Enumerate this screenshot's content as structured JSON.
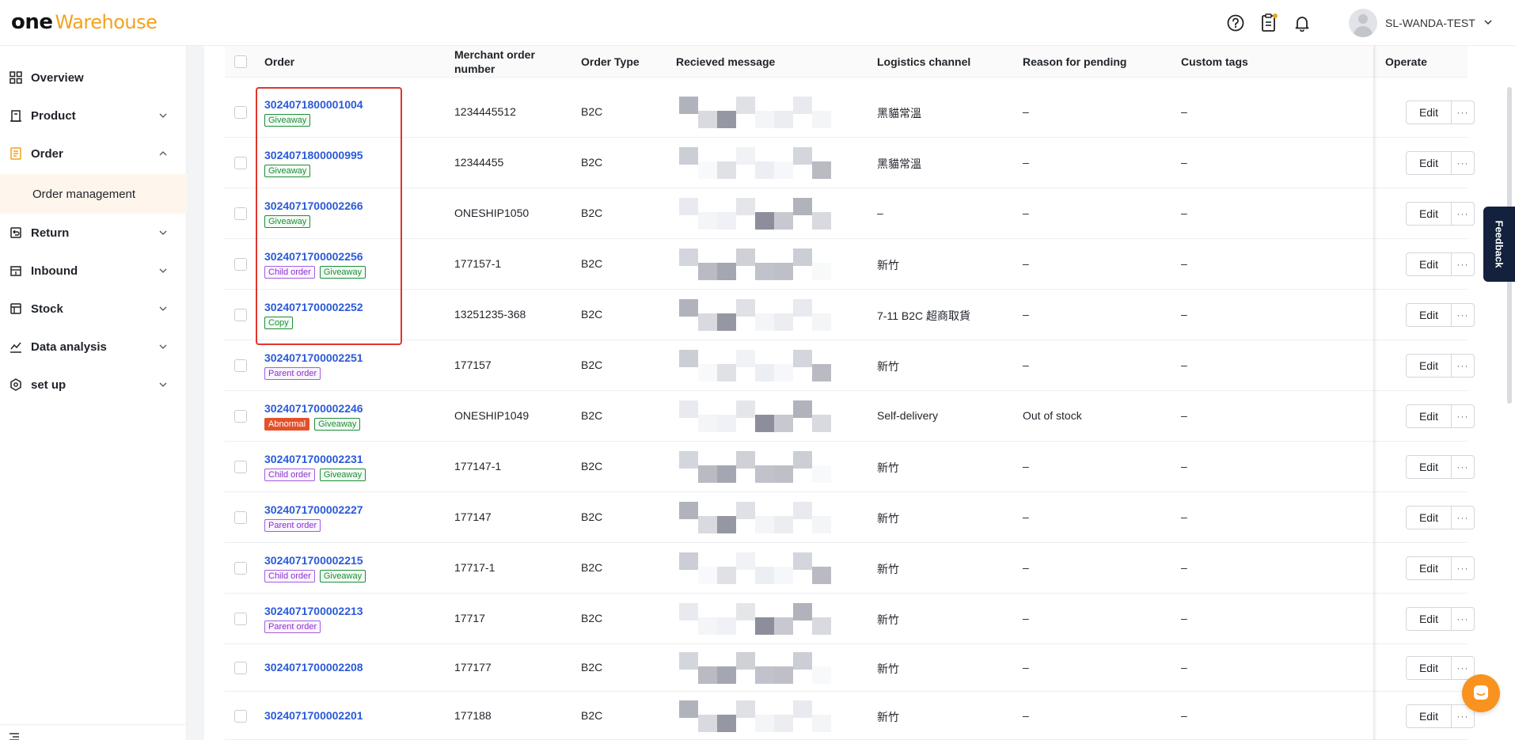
{
  "brand": {
    "one": "one",
    "warehouse": "Warehouse",
    "accent": "#f4a21c"
  },
  "header": {
    "username": "SL-WANDA-TEST"
  },
  "sidebar": {
    "items": [
      {
        "label": "Overview",
        "icon": "overview-icon"
      },
      {
        "label": "Product",
        "icon": "product-icon"
      },
      {
        "label": "Order",
        "icon": "order-icon"
      },
      {
        "label": "Return",
        "icon": "return-icon"
      },
      {
        "label": "Inbound",
        "icon": "inbound-icon"
      },
      {
        "label": "Stock",
        "icon": "stock-icon"
      },
      {
        "label": "Data analysis",
        "icon": "data-analysis-icon"
      },
      {
        "label": "set up",
        "icon": "setup-icon"
      }
    ],
    "sub_item": "Order management"
  },
  "table": {
    "columns": {
      "order": "Order",
      "merchant": "Merchant order number",
      "type": "Order Type",
      "message": "Recieved message",
      "logistics": "Logistics channel",
      "reason": "Reason for pending",
      "tags": "Custom tags",
      "operate": "Operate"
    },
    "edit_label": "Edit",
    "more_label": "···",
    "rows": [
      {
        "order": "3024071800001004",
        "tags": [
          {
            "text": "Giveaway",
            "kind": "green"
          }
        ],
        "merchant": "1234445512",
        "type": "B2C",
        "logistics": "黑貓常溫",
        "reason": "–",
        "custom": "–"
      },
      {
        "order": "3024071800000995",
        "tags": [
          {
            "text": "Giveaway",
            "kind": "green"
          }
        ],
        "merchant": "12344455",
        "type": "B2C",
        "logistics": "黑貓常溫",
        "reason": "–",
        "custom": "–"
      },
      {
        "order": "3024071700002266",
        "tags": [
          {
            "text": "Giveaway",
            "kind": "green"
          }
        ],
        "merchant": "ONESHIP1050",
        "type": "B2C",
        "logistics": "–",
        "reason": "–",
        "custom": "–"
      },
      {
        "order": "3024071700002256",
        "tags": [
          {
            "text": "Child order",
            "kind": "purple"
          },
          {
            "text": "Giveaway",
            "kind": "green"
          }
        ],
        "merchant": "177157-1",
        "type": "B2C",
        "logistics": "新竹",
        "reason": "–",
        "custom": "–"
      },
      {
        "order": "3024071700002252",
        "tags": [
          {
            "text": "Copy",
            "kind": "green"
          }
        ],
        "merchant": "13251235-368",
        "type": "B2C",
        "logistics": "7-11 B2C 超商取貨",
        "reason": "–",
        "custom": "–"
      },
      {
        "order": "3024071700002251",
        "tags": [
          {
            "text": "Parent order",
            "kind": "purple"
          }
        ],
        "merchant": "177157",
        "type": "B2C",
        "logistics": "新竹",
        "reason": "–",
        "custom": "–"
      },
      {
        "order": "3024071700002246",
        "tags": [
          {
            "text": "Abnormal",
            "kind": "red"
          },
          {
            "text": "Giveaway",
            "kind": "green"
          }
        ],
        "merchant": "ONESHIP1049",
        "type": "B2C",
        "logistics": "Self-delivery",
        "reason": "Out of stock",
        "custom": "–"
      },
      {
        "order": "3024071700002231",
        "tags": [
          {
            "text": "Child order",
            "kind": "purple"
          },
          {
            "text": "Giveaway",
            "kind": "green"
          }
        ],
        "merchant": "177147-1",
        "type": "B2C",
        "logistics": "新竹",
        "reason": "–",
        "custom": "–"
      },
      {
        "order": "3024071700002227",
        "tags": [
          {
            "text": "Parent order",
            "kind": "purple"
          }
        ],
        "merchant": "177147",
        "type": "B2C",
        "logistics": "新竹",
        "reason": "–",
        "custom": "–"
      },
      {
        "order": "3024071700002215",
        "tags": [
          {
            "text": "Child order",
            "kind": "purple"
          },
          {
            "text": "Giveaway",
            "kind": "green"
          }
        ],
        "merchant": "17717-1",
        "type": "B2C",
        "logistics": "新竹",
        "reason": "–",
        "custom": "–"
      },
      {
        "order": "3024071700002213",
        "tags": [
          {
            "text": "Parent order",
            "kind": "purple"
          }
        ],
        "merchant": "17717",
        "type": "B2C",
        "logistics": "新竹",
        "reason": "–",
        "custom": "–"
      },
      {
        "order": "3024071700002208",
        "tags": [],
        "merchant": "177177",
        "type": "B2C",
        "logistics": "新竹",
        "reason": "–",
        "custom": "–"
      },
      {
        "order": "3024071700002201",
        "tags": [],
        "merchant": "177188",
        "type": "B2C",
        "logistics": "新竹",
        "reason": "–",
        "custom": "–"
      }
    ]
  },
  "feedback": "Feedback",
  "colors": {
    "link": "#2a5ad7",
    "highlight": "#e0362c",
    "feedback_bg": "#13213c",
    "chat": "#f9921e"
  }
}
